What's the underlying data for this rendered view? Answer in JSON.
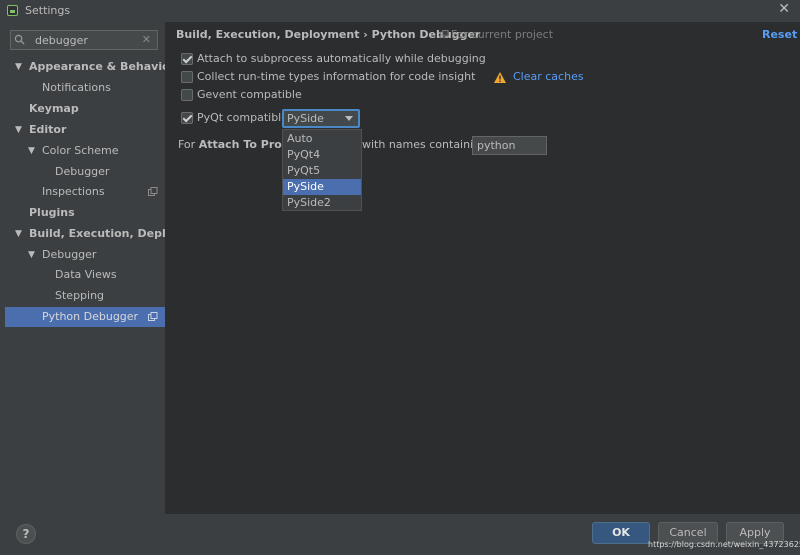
{
  "window": {
    "title": "Settings"
  },
  "search": {
    "value": "debugger"
  },
  "sidebar": {
    "items": [
      {
        "label": "Appearance & Behavior",
        "arrow": "▼"
      },
      {
        "label": "Notifications"
      },
      {
        "label": "Keymap"
      },
      {
        "label": "Editor",
        "arrow": "▼"
      },
      {
        "label": "Color Scheme",
        "arrow": "▼"
      },
      {
        "label": "Debugger"
      },
      {
        "label": "Inspections"
      },
      {
        "label": "Plugins"
      },
      {
        "label": "Build, Execution, Deployment",
        "arrow": "▼"
      },
      {
        "label": "Debugger",
        "arrow": "▼"
      },
      {
        "label": "Data Views"
      },
      {
        "label": "Stepping"
      },
      {
        "label": "Python Debugger"
      }
    ]
  },
  "header": {
    "breadcrumb": "Build, Execution, Deployment › Python Debugger",
    "scope": "For current project",
    "reset": "Reset"
  },
  "options": [
    {
      "label": "Attach to subprocess automatically while debugging",
      "checked": true
    },
    {
      "label": "Collect run-time types information for code insight",
      "checked": false
    },
    {
      "label": "Gevent compatible",
      "checked": false
    },
    {
      "label": "PyQt compatible",
      "checked": true
    }
  ],
  "clear_caches": "Clear caches",
  "pyqt_select": {
    "value": "PySide",
    "options": [
      "Auto",
      "PyQt4",
      "PyQt5",
      "PySide",
      "PySide2"
    ],
    "highlighted": "PySide"
  },
  "attach": {
    "prefix": "For ",
    "bold": "Attach To Process",
    "suffix": "with names containing:",
    "value": "python"
  },
  "buttons": {
    "help": "?",
    "ok": "OK",
    "cancel": "Cancel",
    "apply": "Apply"
  },
  "watermark": "https://blog.csdn.net/weixin_43723625",
  "colors": {
    "accent": "#4b6eaf",
    "link": "#589df6",
    "ok_button": "#365880",
    "warning": "#f0a732"
  }
}
